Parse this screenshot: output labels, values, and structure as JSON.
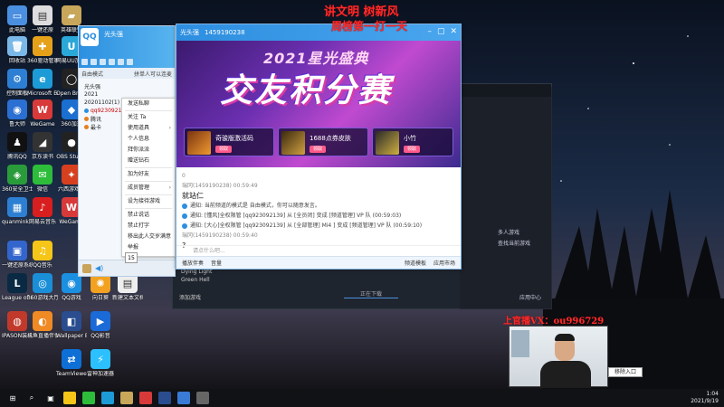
{
  "overlay": {
    "line1": "讲文明 树新风",
    "line2": "周榜第一打一天",
    "contact": "上官播VX：ou996729"
  },
  "desktop_icons": [
    {
      "label": "此电脑",
      "color": "#4a8fe0",
      "glyph": "▭"
    },
    {
      "label": "一键还原",
      "color": "#ddd",
      "glyph": "▤"
    },
    {
      "label": "回收站",
      "color": "#7ab8e8",
      "glyph": "🗑"
    },
    {
      "label": "360驱动管家",
      "color": "#e6a11a",
      "glyph": "✚"
    },
    {
      "label": "控制面板",
      "color": "#2d7fd3",
      "glyph": "⚙"
    },
    {
      "label": "Microsoft Edge",
      "color": "#1d9bd6",
      "glyph": "e"
    },
    {
      "label": "鲁大师",
      "color": "#2a6fd1",
      "glyph": "◉"
    },
    {
      "label": "WeGame",
      "color": "#d83a3a",
      "glyph": "W"
    },
    {
      "label": "腾讯QQ",
      "color": "#111",
      "glyph": "♟"
    },
    {
      "label": "京东读书",
      "color": "#333",
      "glyph": "◢"
    },
    {
      "label": "360安全卫士",
      "color": "#2a9b3a",
      "glyph": "◈"
    },
    {
      "label": "微信",
      "color": "#2dbd3a",
      "glyph": "✉"
    },
    {
      "label": "quanmink...",
      "color": "#2d7fd3",
      "glyph": "▦"
    },
    {
      "label": "网易云音乐",
      "color": "#d81e1e",
      "glyph": "♪"
    },
    {
      "label": "一键还原系统",
      "color": "#3366cc",
      "glyph": "▣"
    },
    {
      "label": "QQ音乐",
      "color": "#f5c518",
      "glyph": "♫"
    },
    {
      "label": "League of Legends",
      "color": "#0a2a44",
      "glyph": "L"
    },
    {
      "label": "360游戏大厅",
      "color": "#1a8fd8",
      "glyph": "◎"
    },
    {
      "label": "IPASON装机软件",
      "color": "#c0392b",
      "glyph": "◍"
    },
    {
      "label": "斗鱼直播伴侣",
      "color": "#f08a24",
      "glyph": "◐"
    }
  ],
  "desktop_icons_col2": [
    {
      "label": "英雄联盟",
      "color": "#c8a65a",
      "glyph": "▰"
    },
    {
      "label": "网易UU加速器",
      "color": "#2aa8d8",
      "glyph": "U"
    },
    {
      "label": "Open Broadcast",
      "color": "#222",
      "glyph": "◯"
    },
    {
      "label": "360加速",
      "color": "#1b6fd1",
      "glyph": "◆"
    },
    {
      "label": "OBS Studio",
      "color": "#222",
      "glyph": "●"
    },
    {
      "label": "六西游戏盒",
      "color": "#d6401e",
      "glyph": "✦"
    },
    {
      "label": "WeGame",
      "color": "#d83a3a",
      "glyph": "W"
    },
    {
      "label": "QQ游戏",
      "color": "#1b8fe0",
      "glyph": "◉"
    },
    {
      "label": "Wallpaper Engine",
      "color": "#2a4d8f",
      "glyph": "◧"
    },
    {
      "label": "TeamViewer",
      "color": "#0e6fd6",
      "glyph": "⇄"
    }
  ],
  "desktop_icons_col3": [
    {
      "label": "向日葵",
      "color": "#f2a220",
      "glyph": "✺"
    },
    {
      "label": "新建文本文档(3)",
      "color": "#eee",
      "glyph": "▤"
    },
    {
      "label": "QQ影音",
      "color": "#1a6ad8",
      "glyph": "▶"
    },
    {
      "label": "雷神加速器",
      "color": "#2dc0ff",
      "glyph": "⚡"
    }
  ],
  "qq_panel": {
    "logo": "QQ",
    "nickname": "光头强",
    "sub_left": "自由模式",
    "sub_right": "拼单人可以连麦",
    "tree": [
      {
        "text": "光头强",
        "red": false
      },
      {
        "text": "2021",
        "red": false
      },
      {
        "text": "20201102(1)",
        "red": false
      },
      {
        "text": "qq923092139",
        "red": true
      },
      {
        "text": "腾讯",
        "red": false
      },
      {
        "text": "最卡",
        "red": false
      }
    ]
  },
  "context_menu": {
    "items": [
      {
        "label": "发送私聊",
        "arrow": ""
      },
      {
        "label": "关注 Ta",
        "arrow": ""
      },
      {
        "label": "使用道具",
        "arrow": "›"
      },
      {
        "label": "个人信息",
        "arrow": ""
      },
      {
        "label": "拜你派派",
        "arrow": ""
      },
      {
        "label": "赠送钻石",
        "arrow": ""
      },
      {
        "label": "加为好友",
        "arrow": ""
      },
      {
        "label": "成员管理",
        "arrow": "›"
      },
      {
        "label": "设为接待游戏",
        "arrow": ""
      },
      {
        "label": "禁止说话",
        "arrow": ""
      },
      {
        "label": "禁止打字",
        "arrow": ""
      },
      {
        "label": "移出此人交岁满意",
        "arrow": ""
      },
      {
        "label": "举报",
        "arrow": ""
      }
    ],
    "number_box": "15"
  },
  "chat": {
    "title": "光头强",
    "id": "1459190238",
    "banner_sub": "2021星光盛典",
    "banner_main": "交友积分赛",
    "cards": [
      {
        "text": "奇骏版激活码",
        "btn": "领取"
      },
      {
        "text": "1688点券皮肤",
        "btn": "领取"
      },
      {
        "text": "小竹",
        "btn": "领取"
      }
    ],
    "messages": [
      {
        "text": "0",
        "style": "gray"
      },
      {
        "text": "瑞冈(1459190238)  00:59:49",
        "style": "gray"
      },
      {
        "text": "就站仁",
        "style": "big"
      },
      {
        "text": "通知: 当前频道的模式是 自由模式，你可以随意发言。",
        "style": "sys"
      },
      {
        "text": "通知: [懂风]全权限管 [qq923092139] 从 [全员闭] 变成 [频道管理] VP 队 (00:59:03)",
        "style": "sys"
      },
      {
        "text": "通知: [大心]全权限管 [qq923092139] 从 [全部管理] Mi4 ] 变成 [频道管理] VP 队 (00:59:10)",
        "style": "sys"
      },
      {
        "text": "瑞冈(1459190238)  00:59:40",
        "style": "gray"
      },
      {
        "text": "?",
        "style": "big"
      }
    ],
    "input_placeholder": "请点什么吧...",
    "tools_left": [
      "播放伴奏",
      "音量"
    ],
    "tools_right": [
      "频道模板",
      "应用市场"
    ]
  },
  "game_strip": {
    "items": [
      "多人游戏",
      "查找当前游戏"
    ],
    "footer": "应用中心"
  },
  "bottom_list": [
    "Dying Light",
    "Green Hell"
  ],
  "download_bar": "正在下载",
  "bottom_left_btn": "添加游戏",
  "tooltip": "移除入口",
  "taskbar": {
    "time": "1:04",
    "date": "2021/9/19"
  },
  "colors": {
    "accent": "#2c8fe0",
    "overlay_red": "#ff2a2a"
  }
}
